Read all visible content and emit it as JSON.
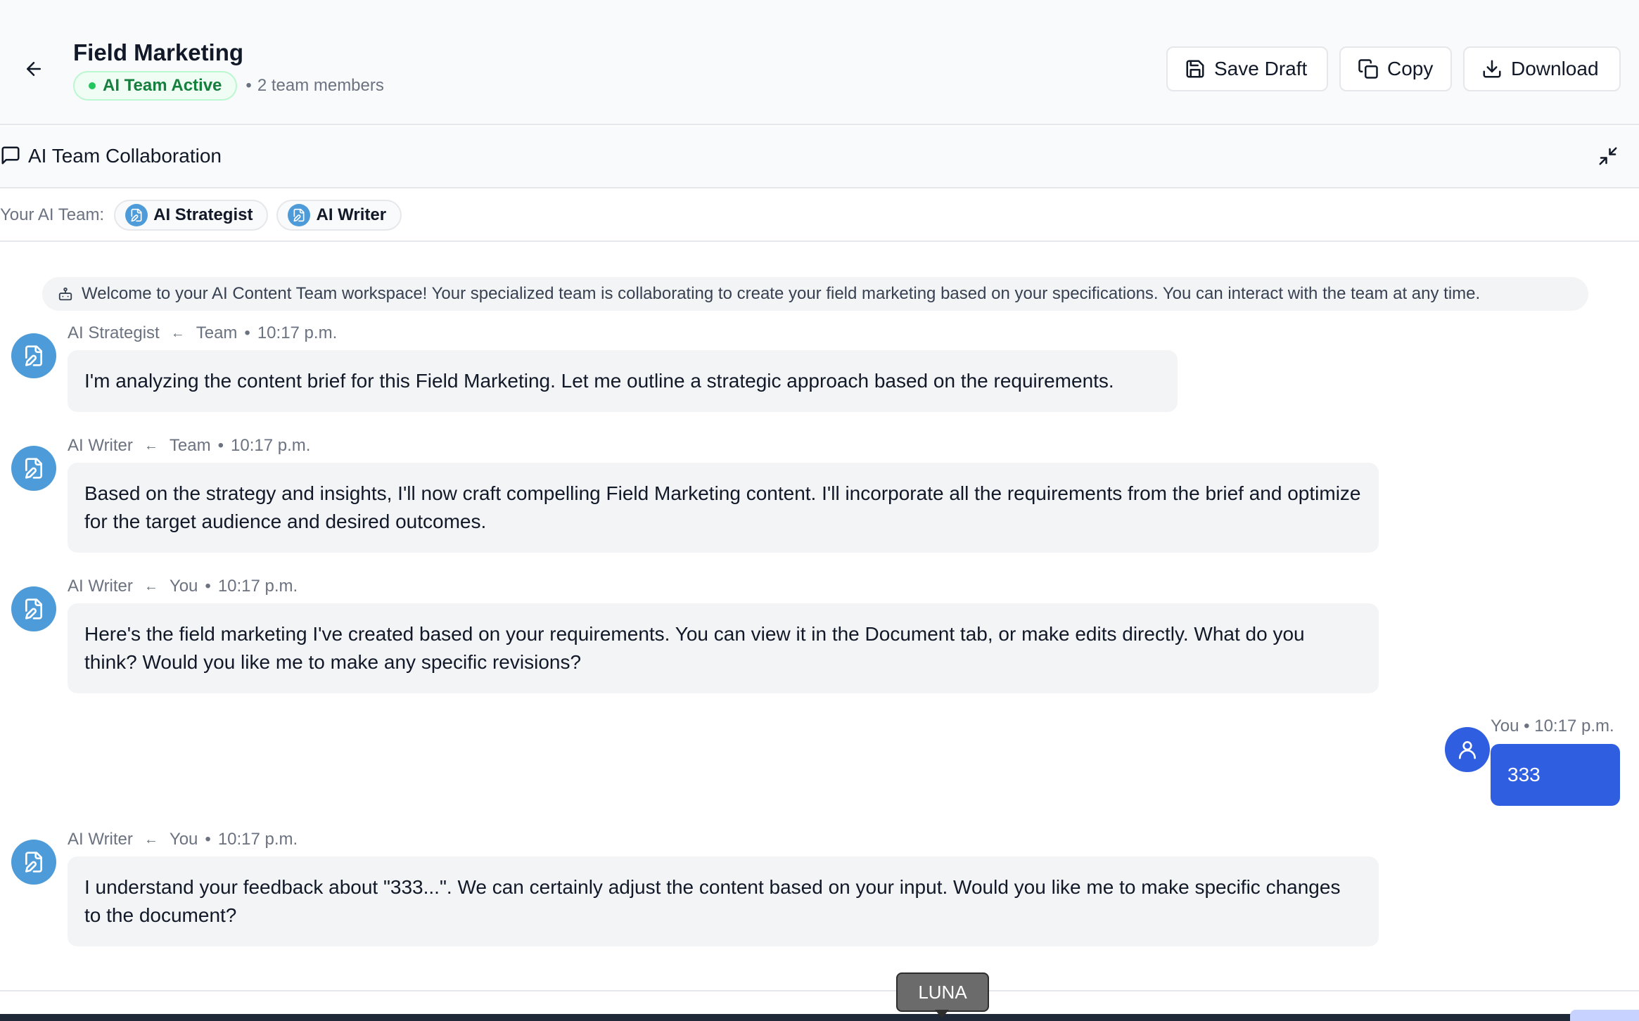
{
  "header": {
    "title": "Field Marketing",
    "status": "AI Team Active",
    "members_sep": "•",
    "members": "2 team members",
    "buttons": {
      "save": "Save Draft",
      "copy": "Copy",
      "download": "Download"
    }
  },
  "collab": {
    "title": "AI Team Collaboration"
  },
  "team": {
    "label": "Your AI Team:",
    "members": [
      "AI Strategist",
      "AI Writer"
    ]
  },
  "welcome": "Welcome to your AI Content Team workspace! Your specialized team is collaborating to create your field marketing based on your specifications. You can interact with the team at any time.",
  "messages": [
    {
      "sender": "AI Strategist",
      "arrow": "←",
      "target": "Team",
      "dot": "•",
      "time": "10:17 p.m.",
      "text": "I'm analyzing the content brief for this Field Marketing. Let me outline a strategic approach based on the requirements."
    },
    {
      "sender": "AI Writer",
      "arrow": "←",
      "target": "Team",
      "dot": "•",
      "time": "10:17 p.m.",
      "text": "Based on the strategy and insights, I'll now craft compelling Field Marketing content. I'll incorporate all the requirements from the brief and optimize for the target audience and desired outcomes."
    },
    {
      "sender": "AI Writer",
      "arrow": "←",
      "target": "You",
      "dot": "•",
      "time": "10:17 p.m.",
      "text": "Here's the field marketing I've created based on your requirements. You can view it in the Document tab, or make edits directly. What do you think? Would you like me to make any specific revisions?"
    },
    {
      "sender": "AI Writer",
      "arrow": "←",
      "target": "You",
      "dot": "•",
      "time": "10:17 p.m.",
      "text": "I understand your feedback about \"333...\". We can certainly adjust the content based on your input. Would you like me to make specific changes to the document?"
    }
  ],
  "user_message": {
    "meta": "You • 10:17 p.m.",
    "text": "333"
  },
  "tooltip": "LUNA",
  "icons": {
    "back": "arrow-left-icon",
    "save": "save-icon",
    "copy": "copy-icon",
    "download": "download-icon",
    "chat": "message-square-icon",
    "minimize": "minimize-icon",
    "agent": "file-pen-icon",
    "bot": "bot-icon",
    "user": "user-icon"
  },
  "colors": {
    "accent": "#2f5ee0",
    "agent_avatar": "#4d9bd9",
    "status_green": "#15803d"
  }
}
